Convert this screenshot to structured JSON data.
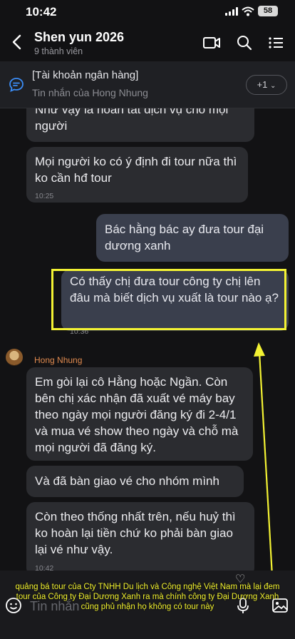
{
  "status": {
    "time": "10:42",
    "battery": "58"
  },
  "header": {
    "title": "Shen yun 2026",
    "subtitle": "9 thành viên"
  },
  "pinned": {
    "title": "[Tài khoản ngân hàng]",
    "sub": "Tin nhắn của Hong Nhung",
    "more": "+1"
  },
  "messages": {
    "m1": "Như vậy là hoàn tất dịch vụ cho mọi người",
    "m2": "Mọi người ko có ý định đi tour nữa thì ko cần hđ tour",
    "m2_time": "10:25",
    "m3": "Bác hằng bác ay đưa tour đại dương xanh",
    "m4": "Có thấy chị đưa tour công ty chị lên đâu mà biết dịch vụ xuất là tour nào ạ?",
    "m4_time": "10:36",
    "sender": "Hong Nhung",
    "m5": "Em gòi lại cô Hằng hoặc Ngần. Còn bên chị xác nhận đã xuất vé máy bay theo ngày mọi người đăng ký đi 2-4/1 và mua vé show theo ngày và chỗ mà mọi người đã đăng ký.",
    "m6": "Và đã bàn giao vé cho nhóm mình",
    "m7": "Còn theo thống nhất  trên, nếu huỷ thì ko hoàn lại tiền chứ ko phải bàn giao lại vé như vậy.",
    "m7_time": "10:42"
  },
  "input": {
    "placeholder": "Tin nhắn"
  },
  "caption": "quảng bá tour của Cty TNHH Du lịch và Công nghệ Việt Nam mà lại đem tour của Công ty Đại Dương Xanh ra mà chính công ty Đại Dương Xanh cũng phủ nhận họ không có tour này",
  "colors": {
    "highlight": "#f3f233",
    "accent_sender": "#e08a4f",
    "background": "#121214"
  }
}
